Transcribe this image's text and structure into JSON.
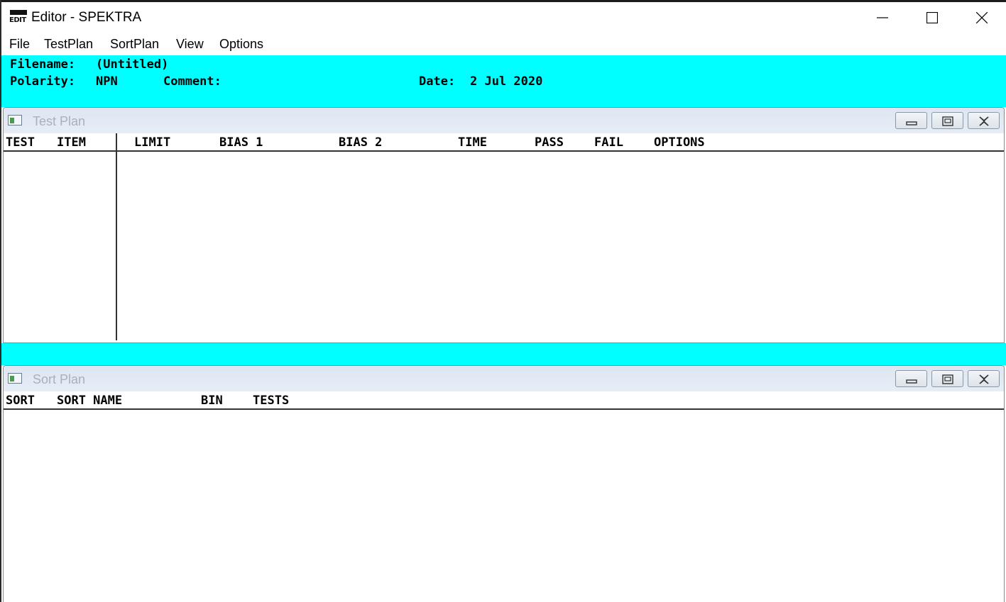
{
  "window": {
    "title": "Editor - SPEKTRA",
    "icon_label": "EDIT"
  },
  "menu": {
    "items": [
      "File",
      "TestPlan",
      "SortPlan",
      "View",
      "Options"
    ]
  },
  "header": {
    "filename_label": "Filename:",
    "filename_value": "(Untitled)",
    "polarity_label": "Polarity:",
    "polarity_value": "NPN",
    "comment_label": "Comment:",
    "comment_value": "",
    "date_label": "Date:",
    "date_value": "2 Jul 2020"
  },
  "test_plan": {
    "title": "Test Plan",
    "columns": [
      "TEST",
      "ITEM",
      "LIMIT",
      "BIAS 1",
      "BIAS 2",
      "TIME",
      "PASS",
      "FAIL",
      "OPTIONS"
    ],
    "rows": []
  },
  "sort_plan": {
    "title": "Sort Plan",
    "columns": [
      "SORT",
      "SORT NAME",
      "BIN",
      "TESTS"
    ],
    "rows": []
  },
  "colors": {
    "header_bg": "#00ffff",
    "child_title_bg": "#dde6f1",
    "child_title_text": "#a9b2bc"
  }
}
